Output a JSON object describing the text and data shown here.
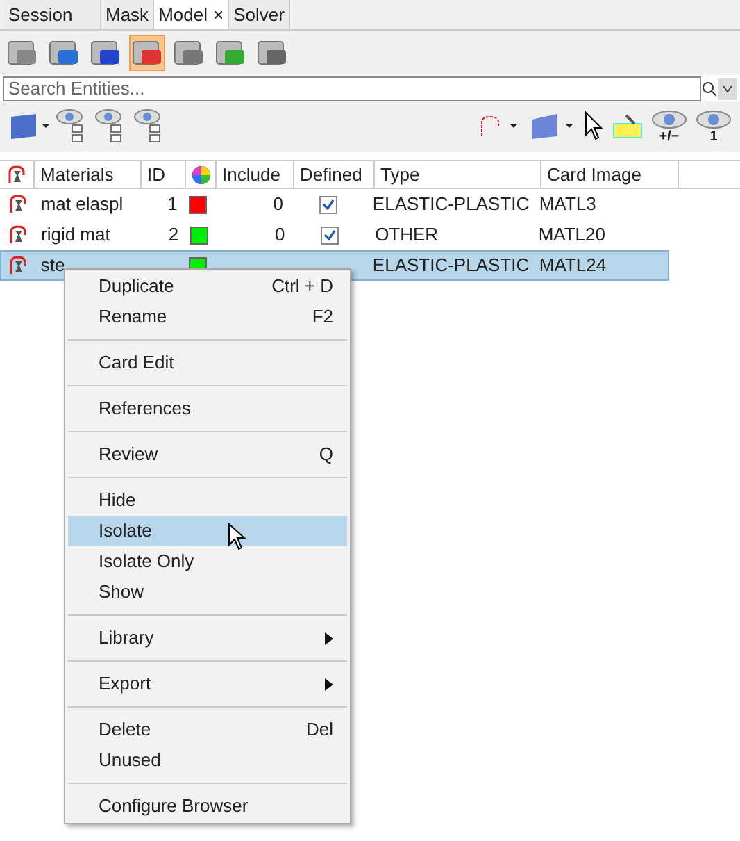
{
  "tabs": [
    {
      "label": "Session",
      "selected": false,
      "closable": false
    },
    {
      "label": "Mask",
      "selected": false,
      "closable": false
    },
    {
      "label": "Model",
      "selected": true,
      "closable": true
    },
    {
      "label": "Solver",
      "selected": false,
      "closable": false
    }
  ],
  "close_glyph": "×",
  "toolbar": [
    {
      "selected": false
    },
    {
      "selected": false
    },
    {
      "selected": false
    },
    {
      "selected": true
    },
    {
      "selected": false
    },
    {
      "selected": false
    },
    {
      "selected": false
    }
  ],
  "search": {
    "placeholder": "Search Entities..."
  },
  "eye_labels": [
    "+/−",
    "1"
  ],
  "table": {
    "columns": [
      "Materials",
      "ID",
      "Include",
      "Defined",
      "Type",
      "Card Image"
    ],
    "rows": [
      {
        "name": "mat elaspl",
        "id": "1",
        "color": "#ff0000",
        "include": "0",
        "defined": true,
        "type": "ELASTIC-PLASTIC",
        "card": "MATL3",
        "selected": false
      },
      {
        "name": "rigid mat",
        "id": "2",
        "color": "#00ee00",
        "include": "0",
        "defined": true,
        "type": "OTHER",
        "card": "MATL20",
        "selected": false
      },
      {
        "name": "ste",
        "color": "#00ee00",
        "type": "ELASTIC-PLASTIC",
        "card": "MATL24",
        "selected": true
      }
    ]
  },
  "context_menu": [
    [
      {
        "label": "Duplicate",
        "shortcut": "Ctrl + D",
        "selected": false,
        "submenu": false
      },
      {
        "label": "Rename",
        "shortcut": "F2",
        "selected": false,
        "submenu": false
      }
    ],
    [
      {
        "label": "Card Edit",
        "selected": false,
        "submenu": false
      }
    ],
    [
      {
        "label": "References",
        "selected": false,
        "submenu": false
      }
    ],
    [
      {
        "label": "Review",
        "shortcut": "Q",
        "selected": false,
        "submenu": false
      }
    ],
    [
      {
        "label": "Hide",
        "selected": false,
        "submenu": false
      },
      {
        "label": "Isolate",
        "selected": true,
        "submenu": false
      },
      {
        "label": "Isolate Only",
        "selected": false,
        "submenu": false
      },
      {
        "label": "Show",
        "selected": false,
        "submenu": false
      }
    ],
    [
      {
        "label": "Library",
        "selected": false,
        "submenu": true
      }
    ],
    [
      {
        "label": "Export",
        "selected": false,
        "submenu": true
      }
    ],
    [
      {
        "label": "Delete",
        "shortcut": "Del",
        "selected": false,
        "submenu": false
      },
      {
        "label": "Unused",
        "selected": false,
        "submenu": false
      }
    ],
    [
      {
        "label": "Configure Browser",
        "selected": false,
        "submenu": false
      }
    ]
  ]
}
